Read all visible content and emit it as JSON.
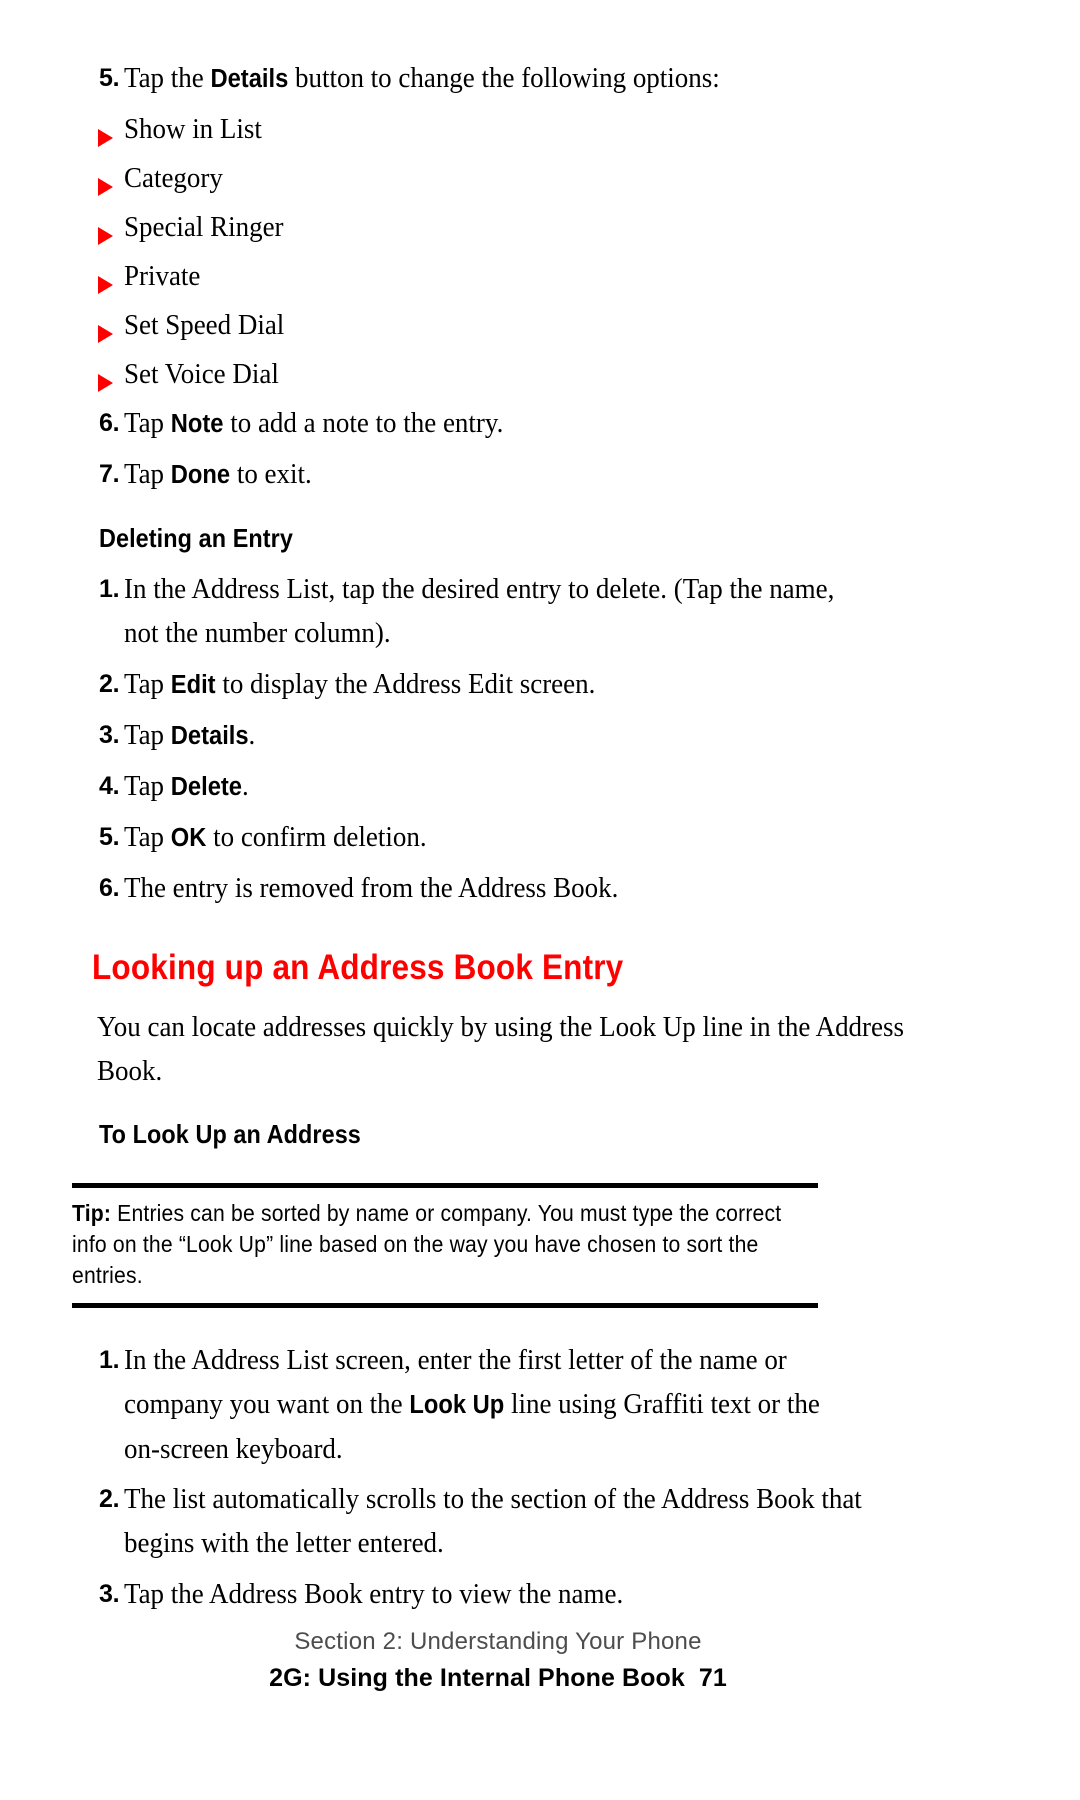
{
  "page": {
    "number": "71",
    "paper_color": "#ffffff",
    "accent_color": "#ff0000"
  },
  "steps_top": [
    {
      "num": "5.",
      "pre": "Tap the ",
      "bold": "Details",
      "post": " button to change the following options:"
    }
  ],
  "detail_options": [
    {
      "bullet": "triangle-bullet-icon",
      "label": "Show in List"
    },
    {
      "bullet": "triangle-bullet-icon",
      "label": "Category"
    },
    {
      "bullet": "triangle-bullet-icon",
      "label": "Special Ringer"
    },
    {
      "bullet": "triangle-bullet-icon",
      "label": "Private"
    },
    {
      "bullet": "triangle-bullet-icon",
      "label": "Set Speed Dial"
    },
    {
      "bullet": "triangle-bullet-icon",
      "label": "Set Voice Dial"
    }
  ],
  "steps_after_bullets": [
    {
      "num": "6.",
      "pre": "Tap ",
      "bold": "Note",
      "post": " to add a note to the entry."
    },
    {
      "num": "7.",
      "pre": "Tap ",
      "bold": "Done",
      "post": " to exit."
    }
  ],
  "deleting_section": {
    "heading": "Deleting an Entry",
    "steps": [
      {
        "num": "1.",
        "pre": "In the Address List, tap the desired entry to delete. (Tap the name, not the number column).",
        "bold": "",
        "post": ""
      },
      {
        "num": "2.",
        "pre": "Tap ",
        "bold": "Edit",
        "post": " to display the Address Edit screen."
      },
      {
        "num": "3.",
        "pre": "Tap ",
        "bold": "Details",
        "post": "."
      },
      {
        "num": "4.",
        "pre": "Tap ",
        "bold": "Delete",
        "post": "."
      },
      {
        "num": "5.",
        "pre": "Tap ",
        "bold": "OK",
        "post": " to confirm deletion."
      },
      {
        "num": "6.",
        "pre": "The entry is removed from the Address Book.",
        "bold": "",
        "post": ""
      }
    ]
  },
  "lookup_section": {
    "heading": "Looking up an Address Book Entry",
    "intro": "You can locate addresses quickly by using the Look Up line in the Address Book.",
    "subheading": "To Look Up an Address",
    "tip": {
      "label": "Tip:",
      "text": " Entries can be sorted by name or company. You must type the correct info on the “Look Up” line based on the way you have chosen to sort the entries."
    },
    "steps": [
      {
        "num": "1.",
        "pre": "In the Address List screen, enter the first letter of the name or company you want on the ",
        "bold": "Look Up",
        "post": " line using Graffiti text or the on-screen keyboard."
      },
      {
        "num": "2.",
        "pre": "The list automatically scrolls to the section of the Address Book that begins with the letter entered.",
        "bold": "",
        "post": ""
      },
      {
        "num": "3.",
        "pre": "Tap the Address Book entry to view the name.",
        "bold": "",
        "post": ""
      }
    ]
  },
  "footer": {
    "section_line": "Section 2: Understanding Your Phone",
    "chapter_line": "2G: Using the Internal Phone Book",
    "page_number": "71"
  }
}
